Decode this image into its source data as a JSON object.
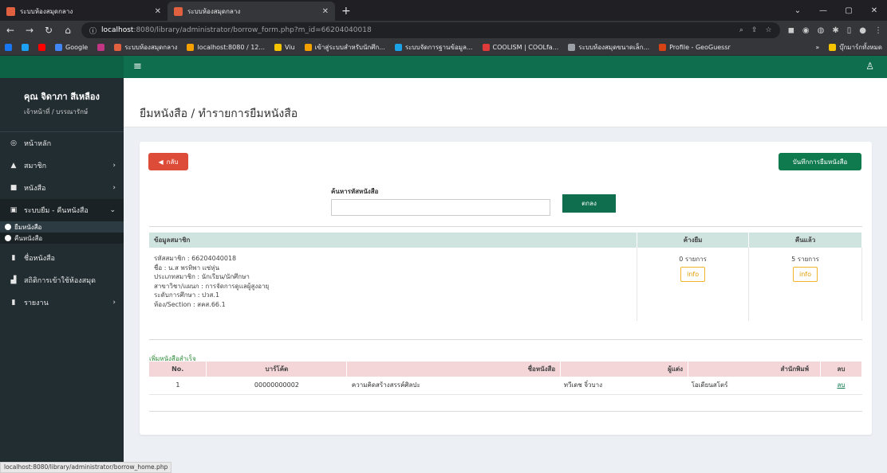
{
  "browser": {
    "tabs": [
      {
        "title": "ระบบห้องสมุดกลาง",
        "active": false
      },
      {
        "title": "ระบบห้องสมุดกลาง",
        "active": true
      }
    ],
    "url_host": "localhost",
    "url_path": ":8080/library/administrator/borrow_form.php?m_id=66204040018",
    "bookmarks": [
      {
        "label": "Google",
        "color": "#4285f4"
      },
      {
        "label": "ระบบห้องสมุดกลาง",
        "color": "#e0603f"
      },
      {
        "label": "localhost:8080 / 12...",
        "color": "#f4a100"
      },
      {
        "label": "Viu",
        "color": "#f5c400"
      },
      {
        "label": "เข้าสู่ระบบสำหรับนักศึก...",
        "color": "#f4a100"
      },
      {
        "label": "ระบบจัดการฐานข้อมูล...",
        "color": "#1aa3e8"
      },
      {
        "label": "COOLISM | COOLfa...",
        "color": "#e03b3b"
      },
      {
        "label": "ระบบห้องสมุดขนาดเล็ก...",
        "color": "#9aa0a6"
      },
      {
        "label": "Profile - GeoGuessr",
        "color": "#d84315"
      },
      {
        "label": "บุ๊กมาร์กทั้งหมด",
        "color": "#f5c400"
      }
    ]
  },
  "sidebar": {
    "user_name": "คุณ จิดาภา สีเหลือง",
    "user_role": "เจ้าหน้าที่ / บรรณารักษ์",
    "items": [
      {
        "label": "หน้าหลัก",
        "icon": "dashboard-icon",
        "glyph": "◎"
      },
      {
        "label": "สมาชิก",
        "icon": "user-icon",
        "glyph": "▲"
      },
      {
        "label": "หนังสือ",
        "icon": "book-icon",
        "glyph": "■"
      },
      {
        "label": "ระบบยืม - คืนหนังสือ",
        "icon": "list-icon",
        "glyph": "▣"
      },
      {
        "label": "ยืมหนังสือ"
      },
      {
        "label": "คืนหนังสือ"
      },
      {
        "label": "ชื่อหนังสือ",
        "icon": "file-icon",
        "glyph": "▮"
      },
      {
        "label": "สถิติการเข้าใช้ห้องสมุด",
        "icon": "bar-chart-icon",
        "glyph": "▟"
      },
      {
        "label": "รายงาน",
        "icon": "report-icon",
        "glyph": "▮"
      }
    ]
  },
  "page": {
    "title": "ยืมหนังสือ / ทำรายการยืมหนังสือ",
    "back_label": "กลับ",
    "save_label": "บันทึกการยืมหนังสือ",
    "search_label": "ค้นหารหัสหนังสือ",
    "search_value": "",
    "ok_label": "ตกลง"
  },
  "member": {
    "headers": [
      "ข้อมูลสมาชิก",
      "ค้างยืม",
      "คืนแล้ว"
    ],
    "lines": [
      "รหัสสมาชิก : 66204040018",
      "ชื่อ : น.ส พรทิพา แซ่หุ่น",
      "ประเภทสมาชิก : นักเรียน/นักศึกษา",
      "สาขาวิชา/แผนก : การจัดการดูแลผู้สูงอายุ",
      "ระดับการศึกษา : ปวส.1",
      "ห้อง/Section : สคส.66.1"
    ],
    "borrowed_count": "0 รายการ",
    "returned_count": "5 รายการ",
    "info_label": "info"
  },
  "books": {
    "success_message": "เพิ่มหนังสือสำเร็จ",
    "headers": [
      "No.",
      "บาร์โค้ด",
      "ชื่อหนังสือ",
      "ผู้แต่ง",
      "สำนักพิมพ์",
      "ลบ"
    ],
    "rows": [
      {
        "no": "1",
        "barcode": "00000000002",
        "title": "ความคิดสร้างสรรค์ศิลปะ",
        "author": "ทวีเดช จิ๋วบาง",
        "publisher": "โอเดียนสโตร์",
        "delete": "ลบ"
      }
    ]
  },
  "statusbar": "localhost:8080/library/administrator/borrow_home.php",
  "colors": {
    "primary": "#0e6e4e",
    "danger": "#dd4b39",
    "sidebar": "#222d32"
  }
}
